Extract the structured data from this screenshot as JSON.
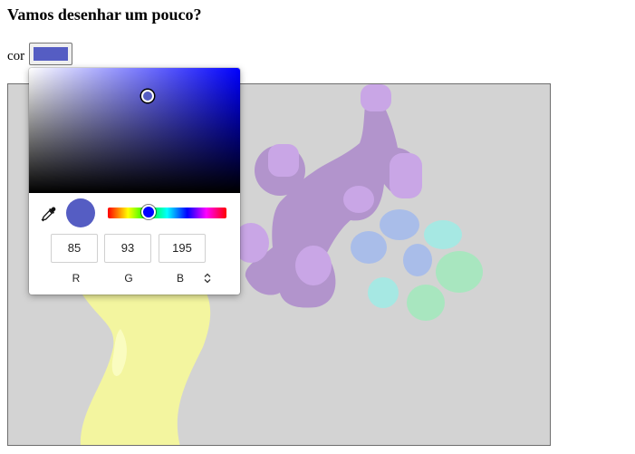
{
  "page": {
    "title": "Vamos desenhar um pouco?",
    "color_label": "cor",
    "selected_color": "#555dc3"
  },
  "color_picker": {
    "hue_color": "#0000ff",
    "channels": [
      {
        "label": "R",
        "value": "85"
      },
      {
        "label": "G",
        "value": "93"
      },
      {
        "label": "B",
        "value": "195"
      }
    ],
    "icons": [
      "eyedropper-icon",
      "format-toggle-icon"
    ]
  },
  "canvas": {
    "background": "#d3d3d3",
    "stroke_colors": [
      "#b294cc",
      "#c9a6e6",
      "#a9bde9",
      "#a6e8e3",
      "#a8e6bf",
      "#f3f59f"
    ]
  }
}
